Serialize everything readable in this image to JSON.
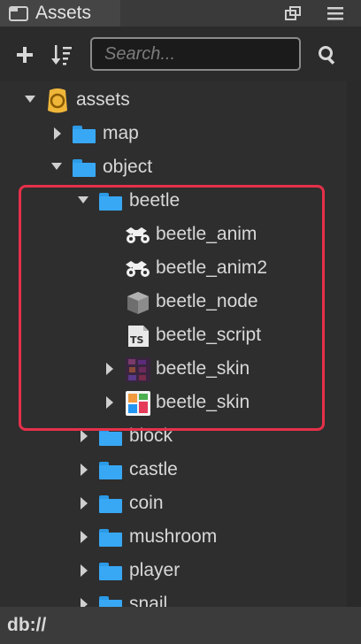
{
  "panel": {
    "title": "Assets"
  },
  "toolbar": {
    "search_placeholder": "Search..."
  },
  "tree": {
    "assets": "assets",
    "map": "map",
    "object": "object",
    "beetle": "beetle",
    "beetle_anim": "beetle_anim",
    "beetle_anim2": "beetle_anim2",
    "beetle_node": "beetle_node",
    "beetle_script": "beetle_script",
    "beetle_skin_1": "beetle_skin",
    "beetle_skin_2": "beetle_skin",
    "block": "block",
    "castle": "castle",
    "coin": "coin",
    "mushroom": "mushroom",
    "player": "player",
    "snail": "snail"
  },
  "status": {
    "path": "db://"
  },
  "colors": {
    "highlight": "#e6304a",
    "folder": "#38a8f5",
    "assets_root": "#f0b63a"
  }
}
